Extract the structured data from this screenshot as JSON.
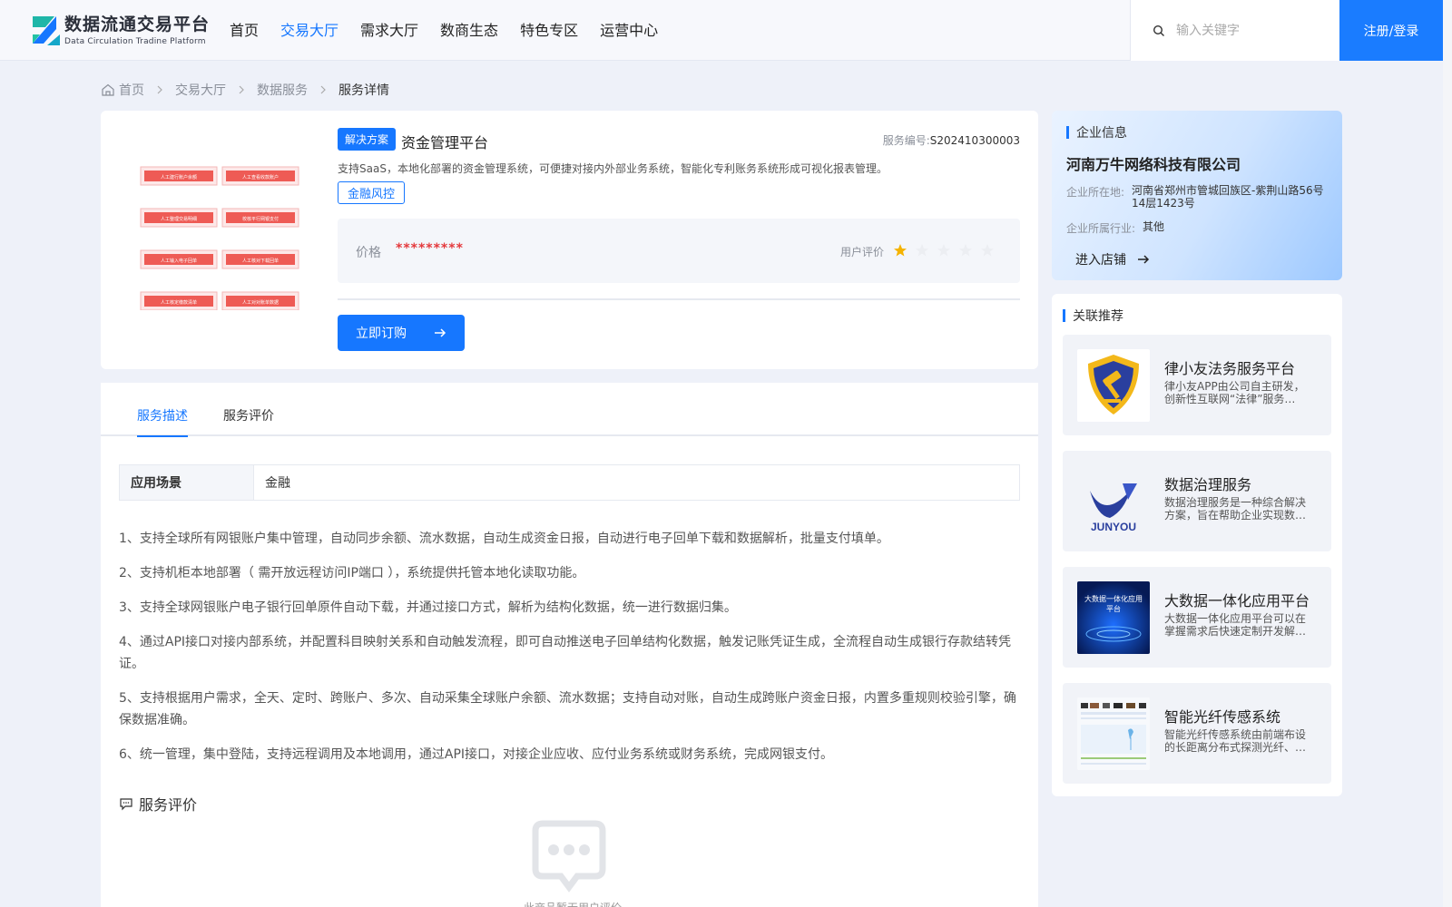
{
  "header": {
    "logo_cn": "数据流通交易平台",
    "logo_en": "Data Circulation Tradine Platform",
    "nav": [
      "首页",
      "交易大厅",
      "需求大厅",
      "数商生态",
      "特色专区",
      "运营中心"
    ],
    "nav_active": "交易大厅",
    "search_placeholder": "输入关键字",
    "login_label": "注册/登录",
    "accent": "#1677ff"
  },
  "breadcrumb": [
    "首页",
    "交易大厅",
    "数据服务",
    "服务详情"
  ],
  "product": {
    "tag": "解决方案",
    "title": "资金管理平台",
    "code_label": "服务编号:",
    "code": "S202410300003",
    "description": "支持SaaS，本地化部署的资金管理系统，可便捷对接内外部业务系统，智能化专利账务系统形成可视化报表管理。",
    "category": "金融风控",
    "price_label": "价格",
    "price": "*********",
    "rating_label": "用户评价",
    "rating": 1,
    "rating_max": 5,
    "buy_label": "立即订购",
    "image_buttons": [
      "人工建行账户余额",
      "人工查看收款账户",
      "人工整理交易明细",
      "校核平行网银支付",
      "人工输入电子回单",
      "人工核对下载回单",
      "人工核定缴款清单",
      "人工对对账单数据"
    ]
  },
  "detail": {
    "tabs": [
      "服务描述",
      "服务评价"
    ],
    "active_tab": "服务描述",
    "scene_key": "应用场景",
    "scene_value": "金融",
    "paragraphs": [
      "1、支持全球所有网银账户集中管理，自动同步余额、流水数据，自动生成资金日报，自动进行电子回单下载和数据解析，批量支付填单。",
      "2、支持机柜本地部署（ 需开放远程访问IP端口 ），系统提供托管本地化读取功能。",
      "3、支持全球网银账户电子银行回单原件自动下载，并通过接口方式，解析为结构化数据，统一进行数据归集。",
      "4、通过API接口对接内部系统，并配置科目映射关系和自动触发流程，即可自动推送电子回单结构化数据，触发记账凭证生成，全流程自动生成银行存款结转凭证。",
      "5、支持根据用户需求，全天、定时、跨账户、多次、自动采集全球账户余额、流水数据；支持自动对账，自动生成跨账户资金日报，内置多重规则校验引擎，确保数据准确。",
      "6、统一管理，集中登陆，支持远程调用及本地调用，通过API接口，对接企业应收、应付业务系统或财务系统，完成网银支付。"
    ],
    "review_title": "服务评价",
    "empty_text": "此商品暂无用户评价"
  },
  "company": {
    "section_title": "企业信息",
    "name": "河南万牛网络科技有限公司",
    "location_label": "企业所在地:",
    "location": "河南省郑州市管城回族区-紫荆山路56号14层1423号",
    "industry_label": "企业所属行业:",
    "industry": "其他",
    "shop_label": "进入店铺"
  },
  "recommend": {
    "section_title": "关联推荐",
    "items": [
      {
        "title": "律小友法务服务平台",
        "desc": "律小友APP由公司自主研发，创新性互联网“法律”服务…",
        "thumb": "gavel-shield"
      },
      {
        "title": "数据治理服务",
        "desc": "数据治理服务是一种综合解决方案，旨在帮助企业实现数…",
        "thumb": "junyou-logo",
        "thumb_text": "JUNYOU"
      },
      {
        "title": "大数据一体化应用平台",
        "desc": "大数据一体化应用平台可以在掌握需求后快速定制开发解…",
        "thumb": "bigdata-banner",
        "thumb_text": "大数据一体化应用平台"
      },
      {
        "title": "智能光纤传感系统",
        "desc": "智能光纤传感系统由前端布设的长距离分布式探测光纤、…",
        "thumb": "fiber-dashboard"
      }
    ]
  }
}
